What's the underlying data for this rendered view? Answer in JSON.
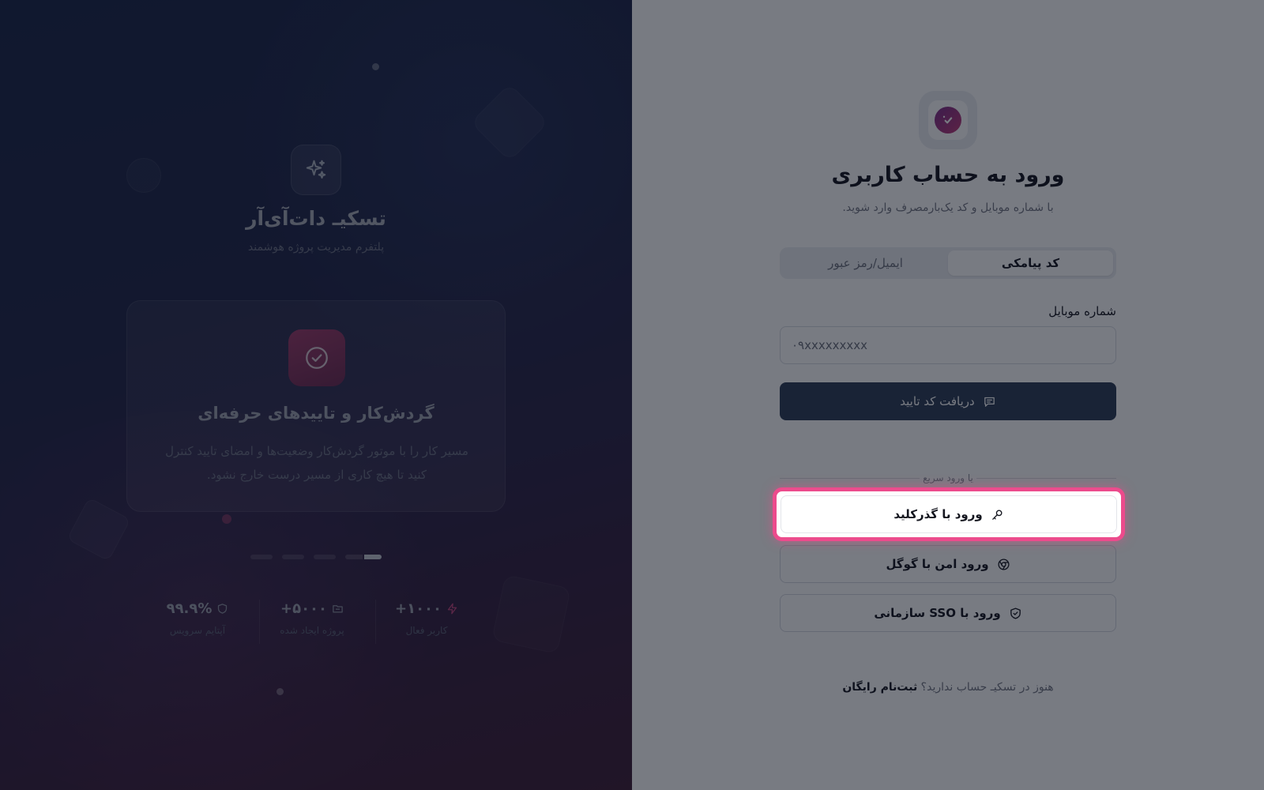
{
  "hero": {
    "brand_name": "تسکیـ دات‌آی‌آر",
    "brand_tagline": "پلتفرم مدیریت پروژه هوشمند",
    "brand_icon": "sparkles-icon",
    "feature": {
      "icon": "check-circle-icon",
      "title": "گردش‌کار و تاییدهای حرفه‌ای",
      "description": "مسیر کار را با موتور گردش‌کار وضعیت‌ها و امضای تایید کنترل کنید تا هیچ کاری از مسیر درست خارج نشود."
    },
    "slider": {
      "count": 4,
      "active_index": 3
    },
    "stats": [
      {
        "value": "۱۰۰۰+",
        "label": "کاربر فعال",
        "icon": "bolt-icon",
        "color": "#c4467e"
      },
      {
        "value": "۵۰۰۰+",
        "label": "پروژه ایجاد شده",
        "icon": "folder-icon",
        "color": "#8d91a0"
      },
      {
        "value": "۹۹.۹%",
        "label": "آپتایم سرویس",
        "icon": "shield-icon",
        "color": "#8d91a0"
      }
    ]
  },
  "form": {
    "title": "ورود به حساب کاربری",
    "subtitle": "با شماره موبایل و کد یک‌بارمصرف وارد شوید.",
    "tabs": [
      {
        "label": "کد پیامکی",
        "active": true
      },
      {
        "label": "ایمیل/رمز عبور",
        "active": false
      }
    ],
    "phone_label": "شماره موبایل",
    "phone_placeholder": "۰۹xxxxxxxxx",
    "phone_value": "",
    "submit_label": "دریافت کد تایید",
    "divider_label": "یا ورود سریع",
    "passkey_label": "ورود با گذرکلید",
    "google_label": "ورود امن با گوگل",
    "sso_label": "ورود با SSO سازمانی",
    "signup_prompt": "هنوز در تسکیـ حساب ندارید؟",
    "signup_link": "ثبت‌نام رایگان"
  },
  "colors": {
    "overlay": "#0a0e1c",
    "highlight": "#ec4b8c",
    "primary": "#2d3c58",
    "brand_gradient_start": "#7a2e8a",
    "brand_gradient_end": "#c23b78"
  }
}
